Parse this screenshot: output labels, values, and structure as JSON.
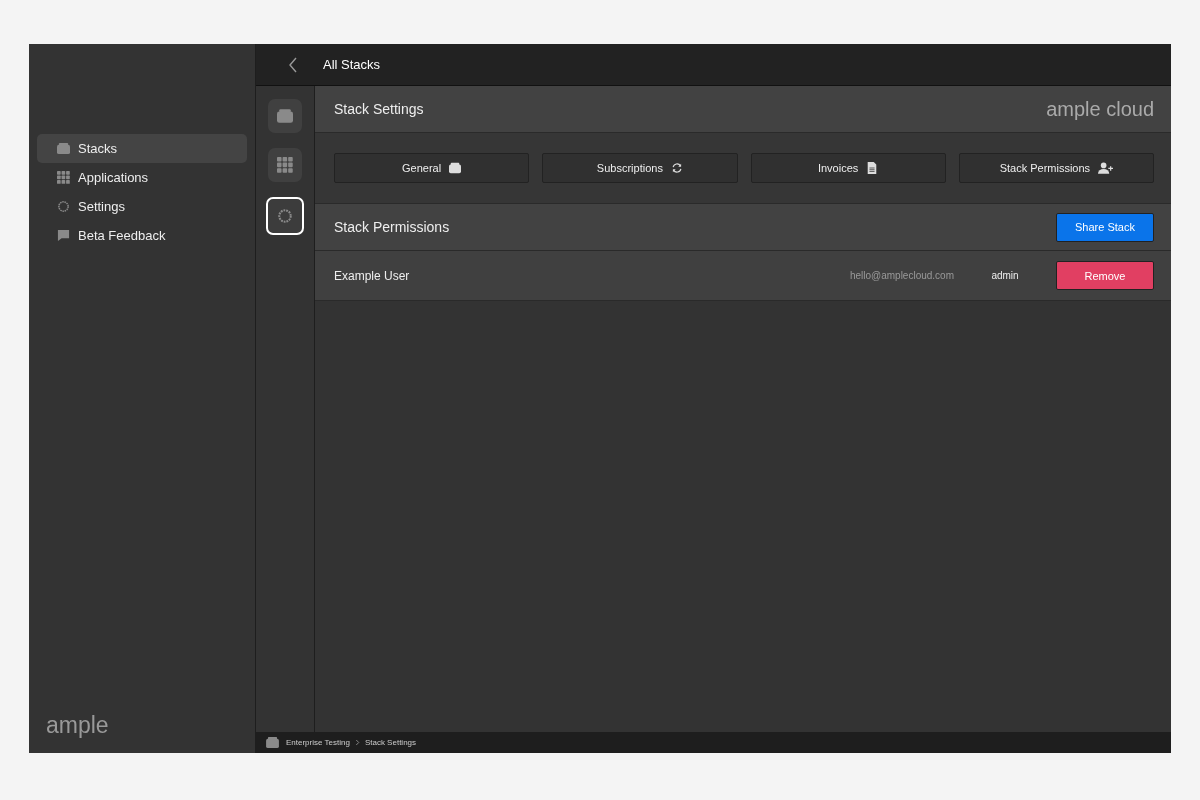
{
  "sidebar": {
    "items": [
      {
        "label": "Stacks",
        "selected": true
      },
      {
        "label": "Applications",
        "selected": false
      },
      {
        "label": "Settings",
        "selected": false
      },
      {
        "label": "Beta Feedback",
        "selected": false
      }
    ],
    "logo": "ample"
  },
  "topbar": {
    "title": "All Stacks"
  },
  "rail": [
    {
      "selected": false
    },
    {
      "selected": false
    },
    {
      "selected": true
    }
  ],
  "header": {
    "title": "Stack Settings",
    "brand": "ample cloud"
  },
  "tabs": [
    {
      "label": "General"
    },
    {
      "label": "Subscriptions"
    },
    {
      "label": "Invoices"
    },
    {
      "label": "Stack Permissions"
    }
  ],
  "permissions": {
    "title": "Stack Permissions",
    "share_button": "Share Stack",
    "rows": [
      {
        "name": "Example User",
        "email": "hello@amplecloud.com",
        "role": "admin",
        "button": "Remove"
      }
    ]
  },
  "breadcrumb": [
    "Enterprise Testing",
    "Stack Settings"
  ]
}
